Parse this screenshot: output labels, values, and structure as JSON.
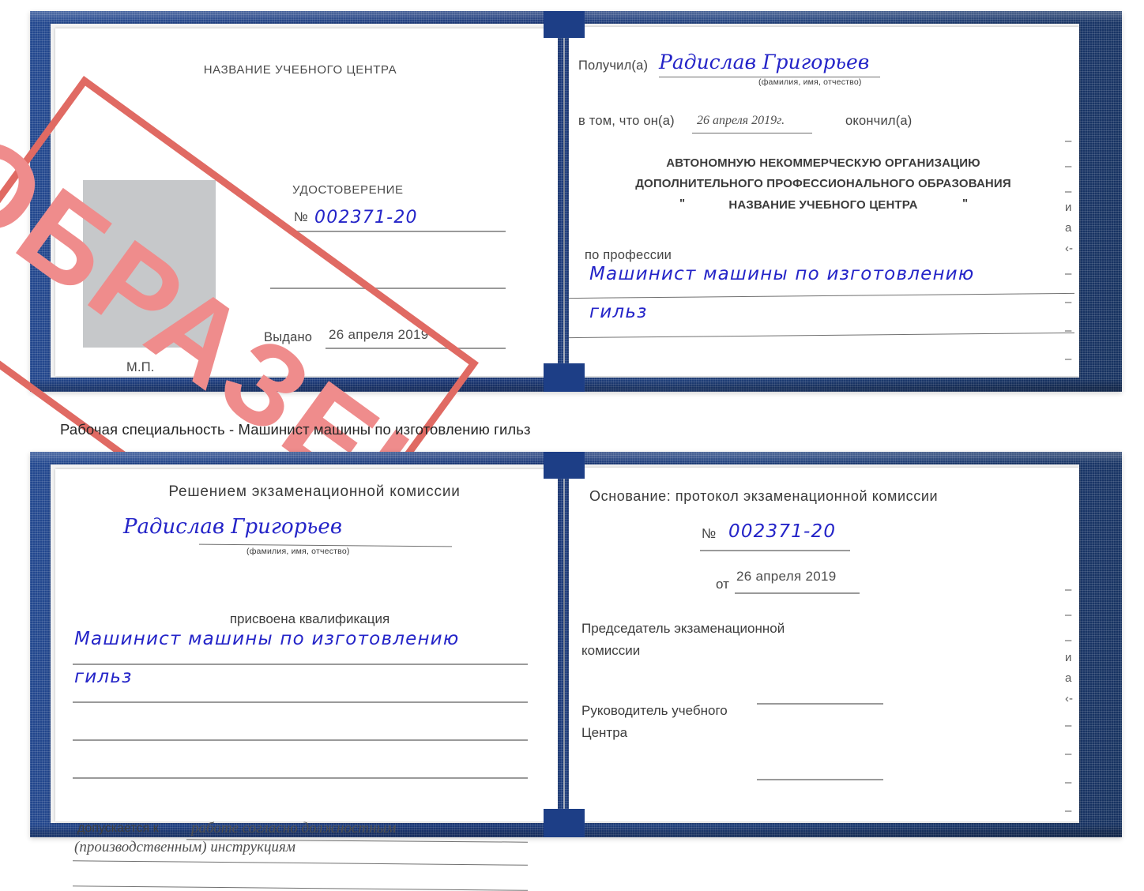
{
  "caption": "Рабочая специальность - Машинист машины по изготовлению гильз",
  "stamp": {
    "text": "ОБРАЗЕЦ",
    "border_color": "#e06a63",
    "fill_color": "#ef8c8c"
  },
  "colors": {
    "cover_blue": "#1d3e86",
    "paper_white": "#ffffff",
    "ink_blue": "#2424c8",
    "stamp_red": "#e06a63",
    "placeholder_gray": "#c6c8ca",
    "rule_gray": "#9a9a9a"
  },
  "certificate_front": {
    "left_page": {
      "center_name": "НАЗВАНИЕ УЧЕБНОГО ЦЕНТРА",
      "doc_type": "УДОСТОВЕРЕНИЕ",
      "number_symbol": "№",
      "number_value": "002371-20",
      "issued_label": "Выдано",
      "issued_date": "26 апреля 2019",
      "seal_label": "М.П."
    },
    "right_page": {
      "received_label": "Получил(а)",
      "received_name": "Радислав Григорьев",
      "name_hint": "(фамилия, имя, отчество)",
      "in_that_label": "в том, что он(а)",
      "completion_date": "26 апреля 2019г.",
      "finished_label": "окончил(а)",
      "org_line1": "АВТОНОМНУЮ НЕКОММЕРЧЕСКУЮ ОРГАНИЗАЦИЮ",
      "org_line2": "ДОПОЛНИТЕЛЬНОГО ПРОФЕССИОНАЛЬНОГО ОБРАЗОВАНИЯ",
      "org_quote_open": "\"",
      "org_line3": "НАЗВАНИЕ УЧЕБНОГО ЦЕНТРА",
      "org_quote_close": "\"",
      "profession_label": "по профессии",
      "profession_line1": "Машинист машины по изготовлению",
      "profession_line2": "гильз"
    }
  },
  "certificate_back": {
    "left_page": {
      "heading": "Решением экзаменационной комиссии",
      "name": "Радислав Григорьев",
      "name_hint": "(фамилия, имя, отчество)",
      "qualification_label": "присвоена квалификация",
      "qualification_line1": "Машинист машины по изготовлению",
      "qualification_line2": "гильз",
      "admitted_label": "допускается к",
      "admitted_line1": "работе согласно должностным",
      "admitted_line2": "(производственным) инструкциям"
    },
    "right_page": {
      "basis_label": "Основание: протокол экзаменационной комиссии",
      "number_symbol": "№",
      "number_value": "002371-20",
      "from_label": "от",
      "from_date": "26 апреля 2019",
      "chairman_line1": "Председатель экзаменационной",
      "chairman_line2": "комиссии",
      "head_line1": "Руководитель учебного",
      "head_line2": "Центра"
    }
  },
  "margin_glyphs_top": [
    "–",
    "–",
    "–",
    "и",
    "а",
    "‹-",
    "–",
    "–",
    "–",
    "–"
  ],
  "margin_glyphs_bottom": [
    "–",
    "–",
    "–",
    "и",
    "а",
    "‹-",
    "–",
    "–",
    "–",
    "–"
  ]
}
